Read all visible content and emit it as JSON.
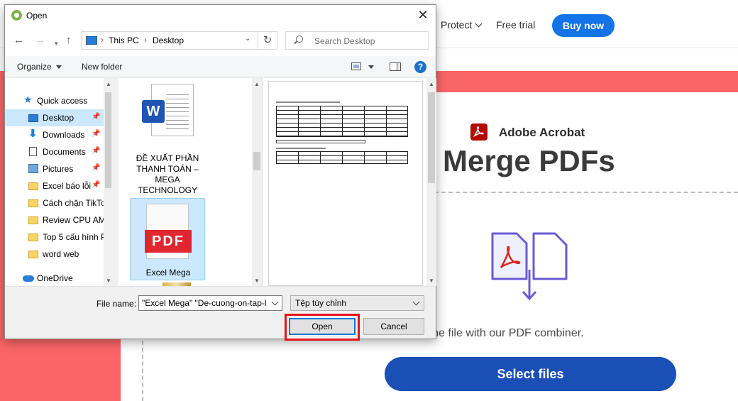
{
  "web": {
    "nav": {
      "protect": "Protect",
      "free_trial": "Free trial",
      "buy_now": "Buy now"
    },
    "brand": "Adobe Acrobat",
    "title": "Merge PDFs",
    "description": "s to merge them into one file with our PDF combiner.",
    "select_files": "Select files",
    "colors": {
      "band": "#fa6567",
      "button": "#1a4fb5",
      "buy": "#1473e6"
    }
  },
  "dialog": {
    "title": "Open",
    "address": {
      "crumbs": [
        "This PC",
        "Desktop"
      ]
    },
    "search": {
      "placeholder": "Search Desktop"
    },
    "toolbar": {
      "organize": "Organize",
      "new_folder": "New folder"
    },
    "nav_items": [
      {
        "label": "Quick access",
        "icon": "star-icon"
      },
      {
        "label": "Desktop",
        "icon": "desktop-icon",
        "selected": true,
        "pinned": true
      },
      {
        "label": "Downloads",
        "icon": "download-icon",
        "pinned": true
      },
      {
        "label": "Documents",
        "icon": "document-icon",
        "pinned": true
      },
      {
        "label": "Pictures",
        "icon": "picture-icon",
        "pinned": true
      },
      {
        "label": "Excel báo lỗi",
        "icon": "folder-icon",
        "pinned": true
      },
      {
        "label": "Cách chặn TikTo",
        "icon": "folder-icon"
      },
      {
        "label": "Review CPU AM",
        "icon": "folder-icon"
      },
      {
        "label": "Top 5 cấu hình P",
        "icon": "folder-icon"
      },
      {
        "label": "word web",
        "icon": "folder-icon"
      },
      {
        "label": "OneDrive",
        "icon": "onedrive-icon"
      }
    ],
    "files": [
      {
        "name": "ĐỀ XUẤT PHẦN THANH TOÁN – MEGA TECHNOLOGY",
        "type": "word"
      },
      {
        "name": "Excel Mega",
        "type": "pdf",
        "selected": true
      }
    ],
    "icon_badges": {
      "word": "W",
      "pdf": "PDF"
    },
    "file_name": {
      "label": "File name:",
      "value": "\"Excel Mega\" \"De-cuong-on-tap-l"
    },
    "file_type": "Tệp tùy chỉnh",
    "buttons": {
      "open": "Open",
      "cancel": "Cancel"
    }
  }
}
